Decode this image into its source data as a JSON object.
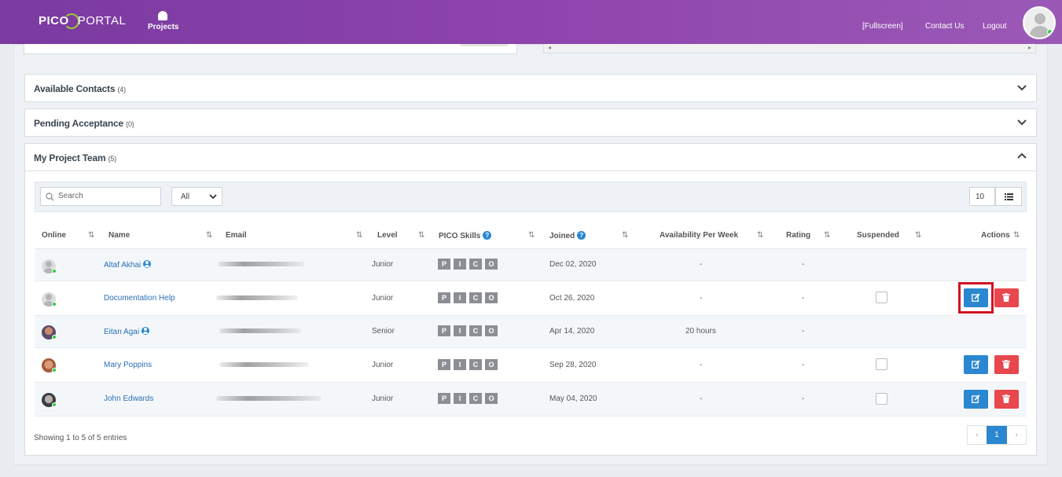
{
  "header": {
    "logo_left": "PICO",
    "logo_right": "PORTAL",
    "nav_projects": "Projects",
    "fullscreen": "[Fullscreen]",
    "contact": "Contact Us",
    "logout": "Logout"
  },
  "panels": {
    "available": {
      "title": "Available Contacts",
      "count": "(4)"
    },
    "pending": {
      "title": "Pending Acceptance",
      "count": "(0)"
    },
    "team": {
      "title": "My Project Team",
      "count": "(5)"
    }
  },
  "toolbar": {
    "search_placeholder": "Search",
    "filter_value": "All",
    "page_size": "10"
  },
  "columns": {
    "online": "Online",
    "name": "Name",
    "email": "Email",
    "level": "Level",
    "skills": "PICO Skills",
    "joined": "Joined",
    "availability": "Availability Per Week",
    "rating": "Rating",
    "suspended": "Suspended",
    "actions": "Actions"
  },
  "skills": [
    "P",
    "I",
    "C",
    "O"
  ],
  "rows": [
    {
      "name": "Altaf Akhai",
      "level": "Junior",
      "joined": "Dec 02, 2020",
      "availability": "-",
      "rating": "-"
    },
    {
      "name": "Documentation Help",
      "level": "Junior",
      "joined": "Oct 26, 2020",
      "availability": "-",
      "rating": "-"
    },
    {
      "name": "Eitan Agai",
      "level": "Senior",
      "joined": "Apr 14, 2020",
      "availability": "20 hours",
      "rating": "-"
    },
    {
      "name": "Mary Poppins",
      "level": "Junior",
      "joined": "Sep 28, 2020",
      "availability": "-",
      "rating": "-"
    },
    {
      "name": "John Edwards",
      "level": "Junior",
      "joined": "May 04, 2020",
      "availability": "-",
      "rating": "-"
    }
  ],
  "footer": {
    "info": "Showing 1 to 5 of 5 entries",
    "page": "1",
    "prev": "‹",
    "next": "›"
  },
  "colors": {
    "header": "#8e44ad",
    "primary": "#2a87d0",
    "danger": "#e8474d",
    "highlight": "#d01224"
  }
}
